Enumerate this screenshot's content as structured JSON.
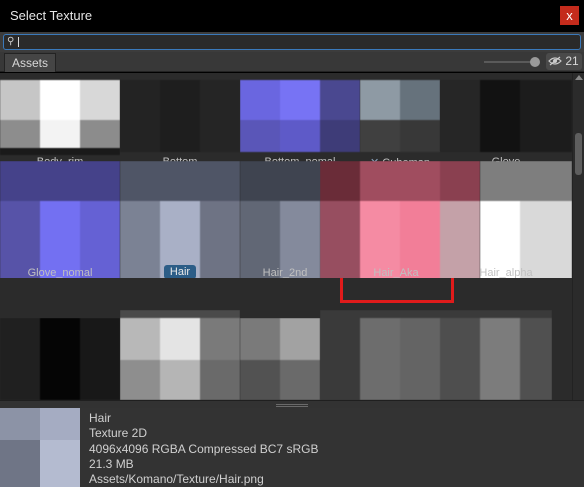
{
  "window": {
    "title": "Select Texture",
    "close_label": "x"
  },
  "search": {
    "value": "",
    "placeholder": ""
  },
  "tabs": {
    "assets_label": "Assets",
    "item_count": "21"
  },
  "assets": [
    {
      "name": "Body_rim",
      "selected": false,
      "icon": null
    },
    {
      "name": "Bottom",
      "selected": false,
      "icon": null
    },
    {
      "name": "Bottom_nomal",
      "selected": false,
      "icon": null
    },
    {
      "name": "Cubemap",
      "selected": false,
      "icon": "cubemap-icon"
    },
    {
      "name": "Glove",
      "selected": false,
      "icon": null
    },
    {
      "name": "Glove_nomal",
      "selected": false,
      "icon": null
    },
    {
      "name": "Hair",
      "selected": true,
      "icon": null
    },
    {
      "name": "Hair_2nd",
      "selected": false,
      "icon": null
    },
    {
      "name": "Hair_Aka",
      "selected": false,
      "icon": null,
      "highlighted": true
    },
    {
      "name": "Hair_alpha",
      "selected": false,
      "icon": null
    }
  ],
  "preview": {
    "name": "Hair",
    "type": "Texture 2D",
    "format": "4096x4096  RGBA Compressed BC7 sRGB",
    "size": "21.3 MB",
    "path": "Assets/Komano/Texture/Hair.png"
  },
  "colors": {
    "selection": "#2c5d87",
    "search_border": "#3a79bb",
    "annotation_red": "#e01b1b",
    "close": "#c42b1c"
  }
}
